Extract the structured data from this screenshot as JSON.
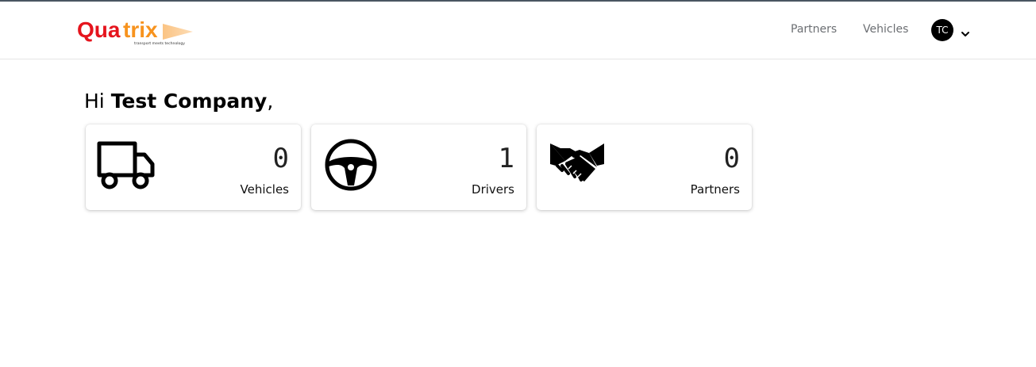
{
  "brand": {
    "name": "Quatrix",
    "tagline": "transport meets technology",
    "colors": {
      "red": "#e5141d",
      "orange": "#f7931e"
    }
  },
  "nav": {
    "links": [
      {
        "label": "Partners"
      },
      {
        "label": "Vehicles"
      }
    ],
    "user": {
      "initials": "TC",
      "menu_icon": "chevron-down-icon"
    }
  },
  "greeting": {
    "prefix": "Hi ",
    "company": "Test Company",
    "suffix": ","
  },
  "stats": [
    {
      "icon": "truck-icon",
      "count": "0",
      "label": "Vehicles"
    },
    {
      "icon": "steering-wheel-icon",
      "count": "1",
      "label": "Drivers"
    },
    {
      "icon": "handshake-icon",
      "count": "0",
      "label": "Partners"
    }
  ]
}
